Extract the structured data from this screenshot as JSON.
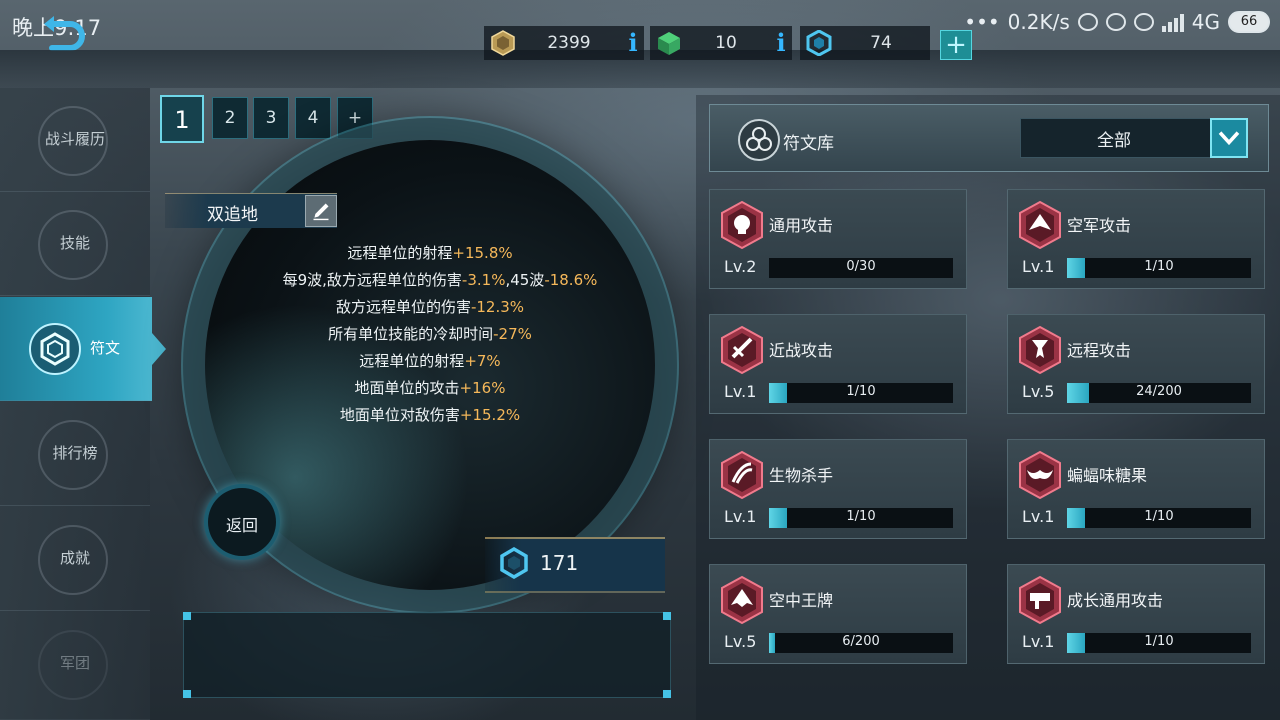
{
  "status": {
    "time": "晚上9:17",
    "speed": "0.2K/s",
    "network": "4G",
    "battery": "66"
  },
  "resources": [
    {
      "name": "gold",
      "value": "2399",
      "info": "i"
    },
    {
      "name": "crystal",
      "value": "10",
      "info": "i"
    },
    {
      "name": "shard",
      "value": "74"
    }
  ],
  "plus_label": "+",
  "sidebar": [
    {
      "label": "战斗履历"
    },
    {
      "label": "技能"
    },
    {
      "label": "符文",
      "active": true
    },
    {
      "label": "排行榜"
    },
    {
      "label": "成就"
    },
    {
      "label": "军团"
    }
  ],
  "page_tabs": [
    "1",
    "2",
    "3",
    "4",
    "+"
  ],
  "loadout": {
    "name": "双追地",
    "bonuses": [
      {
        "text": "远程单位的射程",
        "value": "+15.8%"
      },
      {
        "text": "每9波,敌方远程单位的伤害",
        "value": "-3.1%",
        "text2": ",45波",
        "value2": "-18.6%"
      },
      {
        "text": "敌方远程单位的伤害",
        "value": "-12.3%"
      },
      {
        "text": "所有单位技能的冷却时间",
        "value": "-27%"
      },
      {
        "text": "远程单位的射程",
        "value": "+7%"
      },
      {
        "text": "地面单位的攻击",
        "value": "+16%"
      },
      {
        "text": "地面单位对敌伤害",
        "value": "+15.2%"
      }
    ],
    "back_label": "返回",
    "shards": "171"
  },
  "library": {
    "title": "符文库",
    "filter": "全部",
    "runes": [
      {
        "name": "通用攻击",
        "level": "Lv.2",
        "progress": "0/30",
        "fraction": 0.0
      },
      {
        "name": "空军攻击",
        "level": "Lv.1",
        "progress": "1/10",
        "fraction": 0.1
      },
      {
        "name": "近战攻击",
        "level": "Lv.1",
        "progress": "1/10",
        "fraction": 0.1
      },
      {
        "name": "远程攻击",
        "level": "Lv.5",
        "progress": "24/200",
        "fraction": 0.12
      },
      {
        "name": "生物杀手",
        "level": "Lv.1",
        "progress": "1/10",
        "fraction": 0.1
      },
      {
        "name": "蝙蝠味糖果",
        "level": "Lv.1",
        "progress": "1/10",
        "fraction": 0.1
      },
      {
        "name": "空中王牌",
        "level": "Lv.5",
        "progress": "6/200",
        "fraction": 0.03
      },
      {
        "name": "成长通用攻击",
        "level": "Lv.1",
        "progress": "1/10",
        "fraction": 0.1
      }
    ]
  },
  "colors": {
    "accent": "#2ea5c2",
    "bonus_value": "#f5b85a",
    "rune_red": "#c8455a"
  }
}
